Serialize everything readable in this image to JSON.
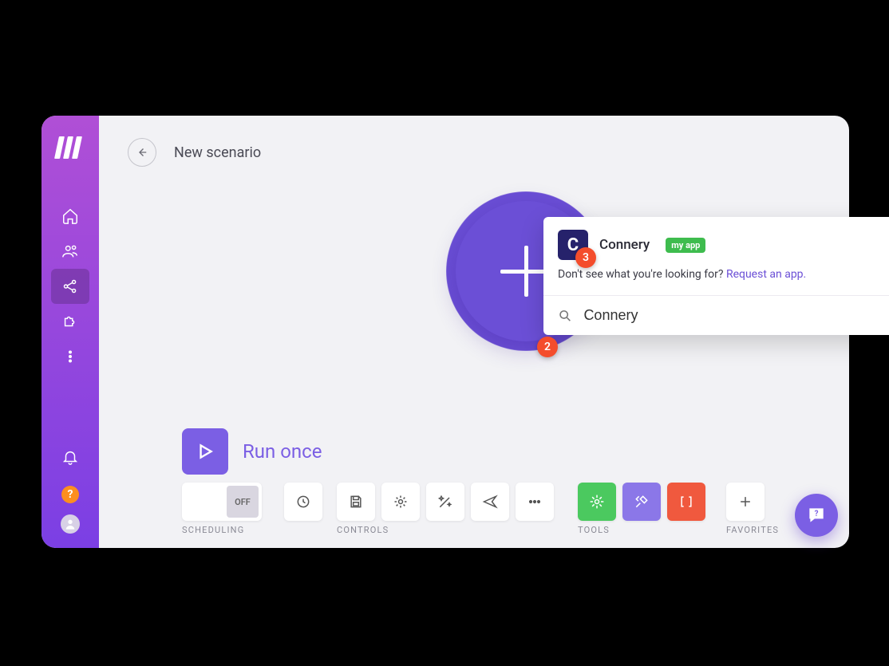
{
  "header": {
    "title": "New scenario"
  },
  "sidebar": {
    "items": [
      "home",
      "users",
      "share",
      "puzzle",
      "more"
    ],
    "active_index": 2
  },
  "node": {
    "type": "add"
  },
  "annotations": {
    "badge_2": "2",
    "badge_3": "3"
  },
  "popover": {
    "app_name": "Connery",
    "app_icon_letter": "C",
    "tag": "my app",
    "request_prefix": "Don't see what you're looking for? ",
    "request_link": "Request an app.",
    "search_value": "Connery"
  },
  "run": {
    "label": "Run once"
  },
  "toolbar": {
    "scheduling_label": "SCHEDULING",
    "scheduling_state": "OFF",
    "controls_label": "CONTROLS",
    "tools_label": "TOOLS",
    "favorites_label": "FAVORITES"
  }
}
